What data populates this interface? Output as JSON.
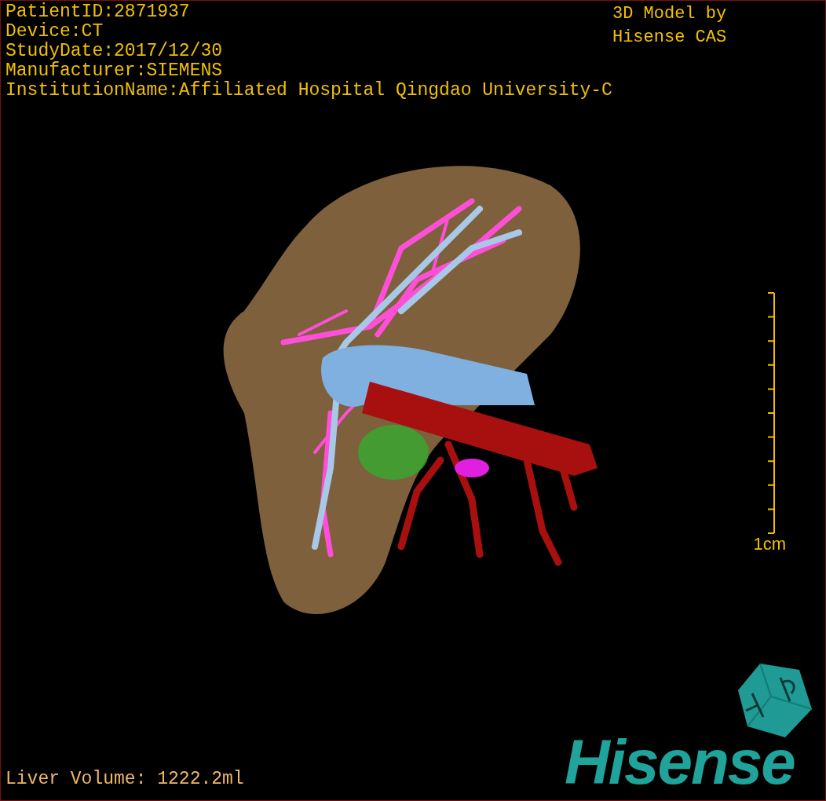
{
  "viewport": {
    "patient_info": [
      "PatientID:2871937",
      "Device:CT",
      "StudyDate:2017/12/30",
      "Manufacturer:SIEMENS",
      "InstitutionName:Affiliated Hospital Qingdao University-C"
    ],
    "model_credit": "3D Model by Hisense CAS",
    "scale_label": "1cm",
    "measurement": "Liver Volume: 1222.2ml",
    "brand": "Hisense"
  }
}
